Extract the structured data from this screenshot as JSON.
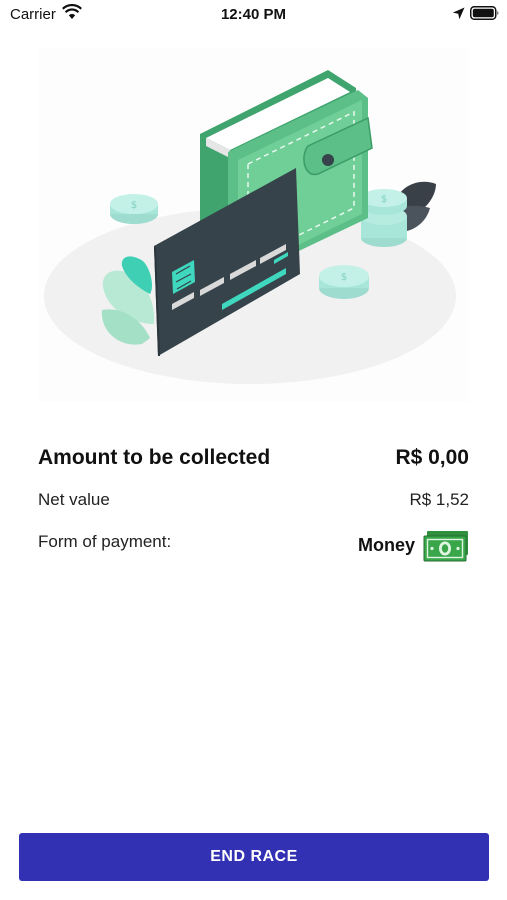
{
  "status_bar": {
    "carrier": "Carrier",
    "time": "12:40 PM",
    "icons": [
      "wifi-icon",
      "location-arrow-icon",
      "battery-icon"
    ]
  },
  "illustration": {
    "subject": "wallet-and-credit-card-illustration",
    "colors": {
      "green": "#5cbf87",
      "teal": "#4fd8be",
      "card": "#36434b",
      "coin": "#b6ece0"
    }
  },
  "summary": {
    "amount_label": "Amount to be collected",
    "amount_value": "R$ 0,00",
    "net_label": "Net value",
    "net_value": "R$ 1,52",
    "payment_label": "Form of payment:",
    "payment_value": "Money",
    "payment_icon": "money-bill-icon"
  },
  "actions": {
    "end_label": "END RACE"
  },
  "colors": {
    "accent": "#3231b3",
    "money_green": "#3aa64a"
  }
}
